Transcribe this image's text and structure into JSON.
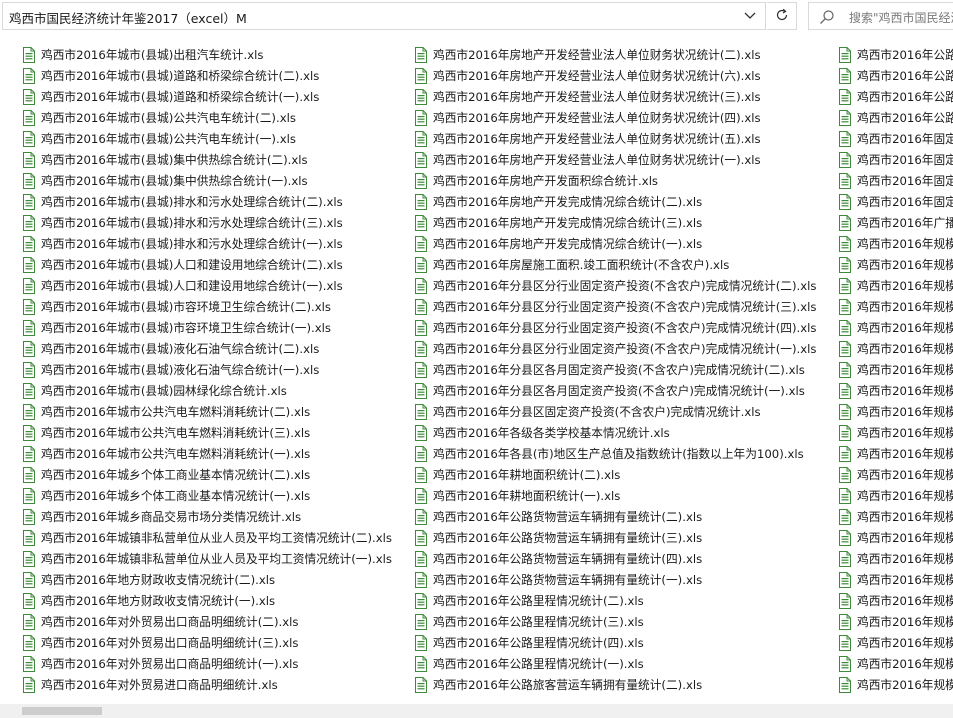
{
  "address_bar": {
    "path": "鸡西市国民经济统计年鉴2017（excel）M"
  },
  "search": {
    "placeholder": "搜索\"鸡西市国民经济"
  },
  "colors": {
    "excel_icon": "#3e8a3a",
    "border": "#d9d9d9"
  },
  "icons": {
    "dropdown": "chevron-down-icon",
    "refresh": "refresh-icon",
    "search": "search-icon",
    "file": "excel-file-icon"
  },
  "files": {
    "columns": [
      [
        "鸡西市2016年城市(县城)出租汽车统计.xls",
        "鸡西市2016年城市(县城)道路和桥梁综合统计(二).xls",
        "鸡西市2016年城市(县城)道路和桥梁综合统计(一).xls",
        "鸡西市2016年城市(县城)公共汽电车统计(二).xls",
        "鸡西市2016年城市(县城)公共汽电车统计(一).xls",
        "鸡西市2016年城市(县城)集中供热综合统计(二).xls",
        "鸡西市2016年城市(县城)集中供热综合统计(一).xls",
        "鸡西市2016年城市(县城)排水和污水处理综合统计(二).xls",
        "鸡西市2016年城市(县城)排水和污水处理综合统计(三).xls",
        "鸡西市2016年城市(县城)排水和污水处理综合统计(一).xls",
        "鸡西市2016年城市(县城)人口和建设用地综合统计(二).xls",
        "鸡西市2016年城市(县城)人口和建设用地综合统计(一).xls",
        "鸡西市2016年城市(县城)市容环境卫生综合统计(二).xls",
        "鸡西市2016年城市(县城)市容环境卫生综合统计(一).xls",
        "鸡西市2016年城市(县城)液化石油气综合统计(二).xls",
        "鸡西市2016年城市(县城)液化石油气综合统计(一).xls",
        "鸡西市2016年城市(县城)园林绿化综合统计.xls",
        "鸡西市2016年城市公共汽电车燃料消耗统计(二).xls",
        "鸡西市2016年城市公共汽电车燃料消耗统计(三).xls",
        "鸡西市2016年城市公共汽电车燃料消耗统计(一).xls",
        "鸡西市2016年城乡个体工商业基本情况统计(二).xls",
        "鸡西市2016年城乡个体工商业基本情况统计(一).xls",
        "鸡西市2016年城乡商品交易市场分类情况统计.xls",
        "鸡西市2016年城镇非私营单位从业人员及平均工资情况统计(二).xls",
        "鸡西市2016年城镇非私营单位从业人员及平均工资情况统计(一).xls",
        "鸡西市2016年地方财政收支情况统计(二).xls",
        "鸡西市2016年地方财政收支情况统计(一).xls",
        "鸡西市2016年对外贸易出口商品明细统计(二).xls",
        "鸡西市2016年对外贸易出口商品明细统计(三).xls",
        "鸡西市2016年对外贸易出口商品明细统计(一).xls",
        "鸡西市2016年对外贸易进口商品明细统计.xls"
      ],
      [
        "鸡西市2016年房地产开发经营业法人单位财务状况统计(二).xls",
        "鸡西市2016年房地产开发经营业法人单位财务状况统计(六).xls",
        "鸡西市2016年房地产开发经营业法人单位财务状况统计(三).xls",
        "鸡西市2016年房地产开发经营业法人单位财务状况统计(四).xls",
        "鸡西市2016年房地产开发经营业法人单位财务状况统计(五).xls",
        "鸡西市2016年房地产开发经营业法人单位财务状况统计(一).xls",
        "鸡西市2016年房地产开发面积综合统计.xls",
        "鸡西市2016年房地产开发完成情况综合统计(二).xls",
        "鸡西市2016年房地产开发完成情况综合统计(三).xls",
        "鸡西市2016年房地产开发完成情况综合统计(一).xls",
        "鸡西市2016年房屋施工面积.竣工面积统计(不含农户).xls",
        "鸡西市2016年分县区分行业固定资产投资(不含农户)完成情况统计(二).xls",
        "鸡西市2016年分县区分行业固定资产投资(不含农户)完成情况统计(三).xls",
        "鸡西市2016年分县区分行业固定资产投资(不含农户)完成情况统计(四).xls",
        "鸡西市2016年分县区分行业固定资产投资(不含农户)完成情况统计(一).xls",
        "鸡西市2016年分县区各月固定资产投资(不含农户)完成情况统计(二).xls",
        "鸡西市2016年分县区各月固定资产投资(不含农户)完成情况统计(一).xls",
        "鸡西市2016年分县区固定资产投资(不含农户)完成情况统计.xls",
        "鸡西市2016年各级各类学校基本情况统计.xls",
        "鸡西市2016年各县(市)地区生产总值及指数统计(指数以上年为100).xls",
        "鸡西市2016年耕地面积统计(二).xls",
        "鸡西市2016年耕地面积统计(一).xls",
        "鸡西市2016年公路货物营运车辆拥有量统计(二).xls",
        "鸡西市2016年公路货物营运车辆拥有量统计(三).xls",
        "鸡西市2016年公路货物营运车辆拥有量统计(四).xls",
        "鸡西市2016年公路货物营运车辆拥有量统计(一).xls",
        "鸡西市2016年公路里程情况统计(二).xls",
        "鸡西市2016年公路里程情况统计(三).xls",
        "鸡西市2016年公路里程情况统计(四).xls",
        "鸡西市2016年公路里程情况统计(一).xls",
        "鸡西市2016年公路旅客营运车辆拥有量统计(二).xls"
      ],
      [
        "鸡西市2016年公路",
        "鸡西市2016年公路",
        "鸡西市2016年公路",
        "鸡西市2016年公路",
        "鸡西市2016年固定",
        "鸡西市2016年固定",
        "鸡西市2016年固定",
        "鸡西市2016年固定",
        "鸡西市2016年广播",
        "鸡西市2016年规模",
        "鸡西市2016年规模",
        "鸡西市2016年规模",
        "鸡西市2016年规模",
        "鸡西市2016年规模",
        "鸡西市2016年规模",
        "鸡西市2016年规模",
        "鸡西市2016年规模",
        "鸡西市2016年规模",
        "鸡西市2016年规模",
        "鸡西市2016年规模",
        "鸡西市2016年规模",
        "鸡西市2016年规模",
        "鸡西市2016年规模",
        "鸡西市2016年规模",
        "鸡西市2016年规模",
        "鸡西市2016年规模",
        "鸡西市2016年规模",
        "鸡西市2016年规模",
        "鸡西市2016年规模",
        "鸡西市2016年规模",
        "鸡西市2016年规模"
      ]
    ]
  }
}
